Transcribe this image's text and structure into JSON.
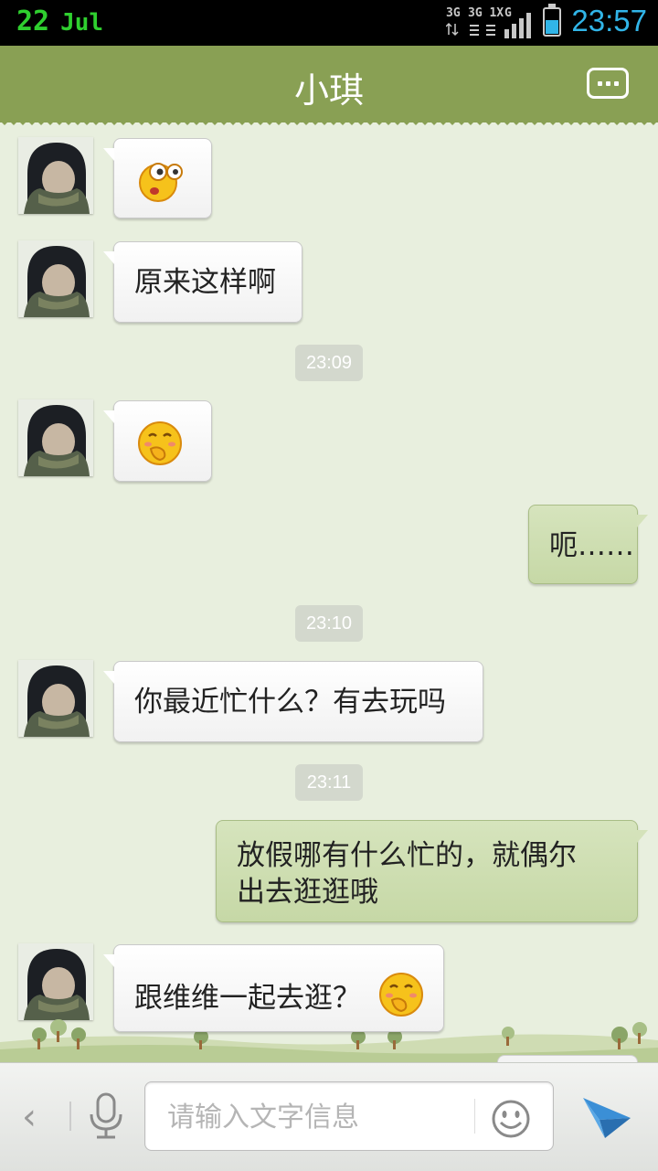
{
  "status_bar": {
    "day": "22",
    "month": "Jul",
    "time": "23:57",
    "network_labels": [
      "3G",
      "3G 1X",
      "G"
    ]
  },
  "header": {
    "title": "小琪",
    "menu_icon": "chat-menu-icon"
  },
  "messages": [
    {
      "direction": "in",
      "emoji": "dizzy-emoji"
    },
    {
      "direction": "in",
      "text": "原来这样啊"
    },
    {
      "timestamp": "23:09"
    },
    {
      "direction": "in",
      "emoji": "shy-emoji"
    },
    {
      "direction": "out",
      "text": "呃……"
    },
    {
      "timestamp": "23:10"
    },
    {
      "direction": "in",
      "text": "你最近忙什么？有去玩吗"
    },
    {
      "timestamp": "23:11"
    },
    {
      "direction": "out",
      "text_lines": [
        "放假哪有什么忙的，就偶尔",
        "出去逛逛哦"
      ]
    },
    {
      "direction": "in",
      "text": "跟维维一起去逛？",
      "emoji": "shy-emoji"
    }
  ],
  "input_bar": {
    "back_label": "‹",
    "placeholder": "请输入文字信息",
    "icons": [
      "back-icon",
      "microphone-icon",
      "smiley-icon",
      "send-icon"
    ]
  },
  "colors": {
    "header": "#89a054",
    "background": "#e8efde",
    "outgoing_bubble": "#c6d8a6",
    "status_accent": "#31b5e8",
    "date_accent": "#2fcf2f"
  }
}
